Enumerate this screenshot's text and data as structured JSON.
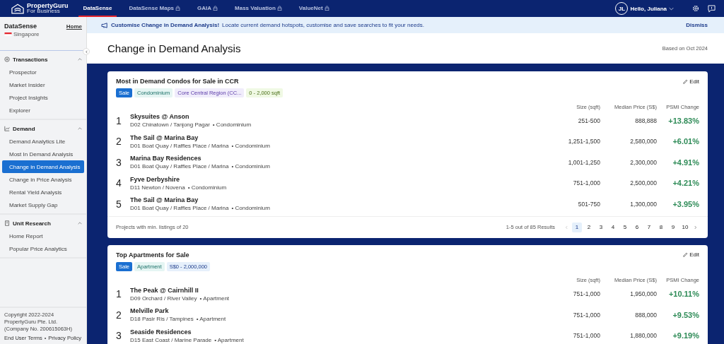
{
  "topbar": {
    "logo": {
      "line1": "PropertyGuru",
      "line2": "For Business"
    },
    "tabs": [
      {
        "label": "DataSense",
        "selected": true,
        "locked": false
      },
      {
        "label": "DataSense Maps",
        "selected": false,
        "locked": true
      },
      {
        "label": "GAIA",
        "selected": false,
        "locked": true
      },
      {
        "label": "Mass Valuation",
        "selected": false,
        "locked": true
      },
      {
        "label": "ValueNet",
        "selected": false,
        "locked": true
      }
    ],
    "user": {
      "initials": "JL",
      "greeting": "Hello, Juliana"
    }
  },
  "sidebar": {
    "title": "DataSense",
    "home_link": "Home",
    "country": "Singapore",
    "sections": [
      {
        "label": "Transactions",
        "expanded": true,
        "items": [
          {
            "label": "Prospector",
            "selected": false
          },
          {
            "label": "Market Insider",
            "selected": false
          },
          {
            "label": "Project Insights",
            "selected": false
          },
          {
            "label": "Explorer",
            "selected": false
          }
        ]
      },
      {
        "label": "Demand",
        "expanded": true,
        "items": [
          {
            "label": "Demand Analytics Lite",
            "selected": false
          },
          {
            "label": "Most In Demand Analysis",
            "selected": false
          },
          {
            "label": "Change in Demand Analysis",
            "selected": true
          },
          {
            "label": "Change in Price Analysis",
            "selected": false
          },
          {
            "label": "Rental Yield Analysis",
            "selected": false
          },
          {
            "label": "Market Supply Gap",
            "selected": false
          }
        ]
      },
      {
        "label": "Unit Research",
        "expanded": true,
        "items": [
          {
            "label": "Home Report",
            "selected": false
          },
          {
            "label": "Popular Price Analytics",
            "selected": false
          }
        ]
      }
    ],
    "footer": {
      "copyright": [
        "Copyright 2022-2024",
        "PropertyGuru Pte. Ltd.",
        "(Company No. 200615063H)"
      ],
      "links": [
        "End User Terms",
        "Privacy Policy"
      ],
      "separator": "•"
    }
  },
  "banner": {
    "title": "Customise Change in Demand Analysis!",
    "text": "Locate current demand hotspots, customise and save searches to fit your needs.",
    "dismiss": "Dismiss"
  },
  "page": {
    "title": "Change in Demand Analysis",
    "based_on": "Based on Oct 2024"
  },
  "cards": [
    {
      "title": "Most in Demand Condos for Sale in CCR",
      "edit": "Edit",
      "tags": [
        {
          "label": "Sale",
          "kind": "primary"
        },
        {
          "label": "Condominium",
          "kind": "teal"
        },
        {
          "label": "Core Central Region (CC...",
          "kind": "purple"
        },
        {
          "label": "0 - 2,000 sqft",
          "kind": "green"
        }
      ],
      "columns": [
        "Size (sqft)",
        "Median Price (S$)",
        "PSMI Change"
      ],
      "rows": [
        {
          "rank": "1",
          "name": "Skysuites @ Anson",
          "district": "D02 Chinatown / Tanjong Pagar",
          "type": "• Condominium",
          "size": "251-500",
          "price": "888,888",
          "change": "+13.83%"
        },
        {
          "rank": "2",
          "name": "The Sail @ Marina Bay",
          "district": "D01 Boat Quay / Raffles Place / Marina",
          "type": "• Condominium",
          "size": "1,251-1,500",
          "price": "2,580,000",
          "change": "+6.01%"
        },
        {
          "rank": "3",
          "name": "Marina Bay Residences",
          "district": "D01 Boat Quay / Raffles Place / Marina",
          "type": "• Condominium",
          "size": "1,001-1,250",
          "price": "2,300,000",
          "change": "+4.91%"
        },
        {
          "rank": "4",
          "name": "Fyve Derbyshire",
          "district": "D11 Newton / Novena",
          "type": "• Condominium",
          "size": "751-1,000",
          "price": "2,500,000",
          "change": "+4.21%"
        },
        {
          "rank": "5",
          "name": "The Sail @ Marina Bay",
          "district": "D01 Boat Quay / Raffles Place / Marina",
          "type": "• Condominium",
          "size": "501-750",
          "price": "1,300,000",
          "change": "+3.95%"
        }
      ],
      "footer": {
        "note": "Projects with min. listings of 20",
        "results": "1-5 out of 85 Results",
        "pages": [
          {
            "label": "1",
            "selected": true
          },
          {
            "label": "2",
            "selected": false
          },
          {
            "label": "3",
            "selected": false
          },
          {
            "label": "4",
            "selected": false
          },
          {
            "label": "5",
            "selected": false
          },
          {
            "label": "6",
            "selected": false
          },
          {
            "label": "7",
            "selected": false
          },
          {
            "label": "8",
            "selected": false
          },
          {
            "label": "9",
            "selected": false
          },
          {
            "label": "10",
            "selected": false
          }
        ]
      }
    },
    {
      "title": "Top Apartments for Sale",
      "edit": "Edit",
      "tags": [
        {
          "label": "Sale",
          "kind": "primary"
        },
        {
          "label": "Apartment",
          "kind": "teal"
        },
        {
          "label": "S$0 - 2,000,000",
          "kind": "blue"
        }
      ],
      "columns": [
        "Size (sqft)",
        "Median Price (S$)",
        "PSMI Change"
      ],
      "rows": [
        {
          "rank": "1",
          "name": "The Peak @ Cairnhill II",
          "district": "D09 Orchard / River Valley",
          "type": "• Apartment",
          "size": "751-1,000",
          "price": "1,950,000",
          "change": "+10.11%"
        },
        {
          "rank": "2",
          "name": "Melville Park",
          "district": "D18 Pasir Ris / Tampines",
          "type": "• Apartment",
          "size": "751-1,000",
          "price": "888,000",
          "change": "+9.53%"
        },
        {
          "rank": "3",
          "name": "Seaside Residences",
          "district": "D15 East Coast / Marine Parade",
          "type": "• Apartment",
          "size": "751-1,000",
          "price": "1,880,000",
          "change": "+9.19%"
        }
      ]
    }
  ]
}
